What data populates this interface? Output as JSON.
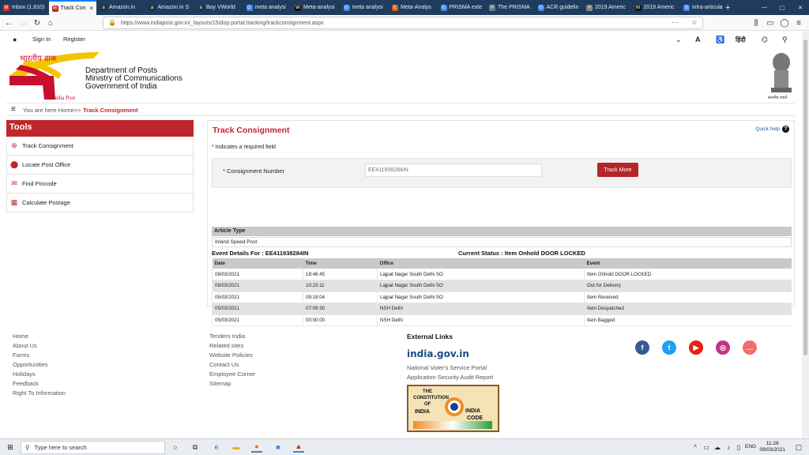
{
  "browser": {
    "tabs": [
      {
        "label": "Inbox (1,810)",
        "color": "#d93025",
        "glyph": "M"
      },
      {
        "label": "Track Con",
        "color": "#c0272d",
        "glyph": "✉"
      },
      {
        "label": "Amazon.in",
        "color": "#232f3e",
        "glyph": "a"
      },
      {
        "label": "Amazon.in S",
        "color": "#232f3e",
        "glyph": "a"
      },
      {
        "label": "Buy VWorld",
        "color": "#232f3e",
        "glyph": "a"
      },
      {
        "label": "meta analysi",
        "color": "#4285f4",
        "glyph": "G"
      },
      {
        "label": "Meta-analysi",
        "color": "#111111",
        "glyph": "W"
      },
      {
        "label": "meta analysi",
        "color": "#4285f4",
        "glyph": "G"
      },
      {
        "label": "Meta-Analys",
        "color": "#e05a00",
        "glyph": "E"
      },
      {
        "label": "PRISMA exte",
        "color": "#4285f4",
        "glyph": "G"
      },
      {
        "label": "The PRISMA",
        "color": "#6b7b8c",
        "glyph": "P"
      },
      {
        "label": "ACR guidelin",
        "color": "#4285f4",
        "glyph": "G"
      },
      {
        "label": "2019 Americ",
        "color": "#8a8a8a",
        "glyph": "•"
      },
      {
        "label": "2019 Americ",
        "color": "#111111",
        "glyph": "W"
      },
      {
        "label": "intra-articula",
        "color": "#4285f4",
        "glyph": "G"
      }
    ],
    "url": "https://www.indiapost.gov.in/_layouts/15/dop.portal.tracking/trackconsignment.aspx"
  },
  "header": {
    "sign_in": "Sign In",
    "register": "Register",
    "hindi": "हिंदी",
    "logo_hindi": "भारतीय डाक",
    "logo_english": "India Post",
    "dept_lines": [
      "Department of Posts",
      "Ministry of Communications",
      "Government of India"
    ],
    "emblem_caption": "सत्यमेव जयते"
  },
  "breadcrumb": {
    "prefix": "You are here Home>> ",
    "current": "Track Consignment"
  },
  "tools": {
    "title": "Tools",
    "items": [
      {
        "label": "Track Consignment",
        "icon": "⊕"
      },
      {
        "label": "Locate Post Office",
        "icon": "⬤"
      },
      {
        "label": "Find Pincode",
        "icon": "✉"
      },
      {
        "label": "Calculate Postage",
        "icon": "▦"
      }
    ]
  },
  "main": {
    "title": "Track Consignment",
    "quick_help": "Quick help",
    "required_note": "* Indicates a required field",
    "consignment_label": "* Consignment Number",
    "consignment_placeholder": "EE411938284IN",
    "track_button": "Track More",
    "article_type_label": "Article Type",
    "article_type_value": "Inland Speed Post",
    "event_details": "Event Details For : EE411938284IN",
    "current_status": "Current Status : Item Onhold DOOR LOCKED",
    "table": {
      "headers": [
        "Date",
        "Time",
        "Office",
        "Event"
      ],
      "rows": [
        [
          "08/03/2021",
          "18:46:45",
          "Lajpat Nagar South Delhi SO",
          "Item Onhold DOOR LOCKED"
        ],
        [
          "08/03/2021",
          "10:23:11",
          "Lajpat Nagar South Delhi SO",
          "Out for Delivery"
        ],
        [
          "05/03/2021",
          "09:18:04",
          "Lajpat Nagar South Delhi SO",
          "Item Received"
        ],
        [
          "05/03/2021",
          "07:09:30",
          "NSH Delhi",
          "Item Despatched"
        ],
        [
          "05/03/2021",
          "00:00:00",
          "NSH Delhi",
          "Item Bagged"
        ]
      ]
    }
  },
  "footer": {
    "col1": [
      "Home",
      "About Us",
      "Forms",
      "Opportunities",
      "Holidays",
      "Feedback",
      "Right To Information"
    ],
    "col2": [
      "Tenders India",
      "Related sites",
      "Website Policies",
      "Contact Us",
      "Employee Corner",
      "Sitemap"
    ],
    "external_title": "External Links",
    "indiagov": "india.gov.in",
    "external_links": [
      "National Voter's Service Portal",
      "Application Security Audit Report"
    ],
    "code_text": [
      "THE",
      "CONSTITUTION",
      "OF",
      "INDIA",
      "INDIA",
      "CODE"
    ],
    "social": [
      {
        "name": "facebook",
        "color": "#3b5998",
        "glyph": "f"
      },
      {
        "name": "twitter",
        "color": "#1da1f2",
        "glyph": "t"
      },
      {
        "name": "youtube",
        "color": "#e62117",
        "glyph": "▶"
      },
      {
        "name": "instagram",
        "color": "#c13584",
        "glyph": "◎"
      },
      {
        "name": "chat",
        "color": "#f26d6d",
        "glyph": "…"
      }
    ]
  },
  "taskbar": {
    "search_placeholder": "Type here to search",
    "lang": "ENG",
    "time": "11:28",
    "date": "09/03/2021"
  }
}
